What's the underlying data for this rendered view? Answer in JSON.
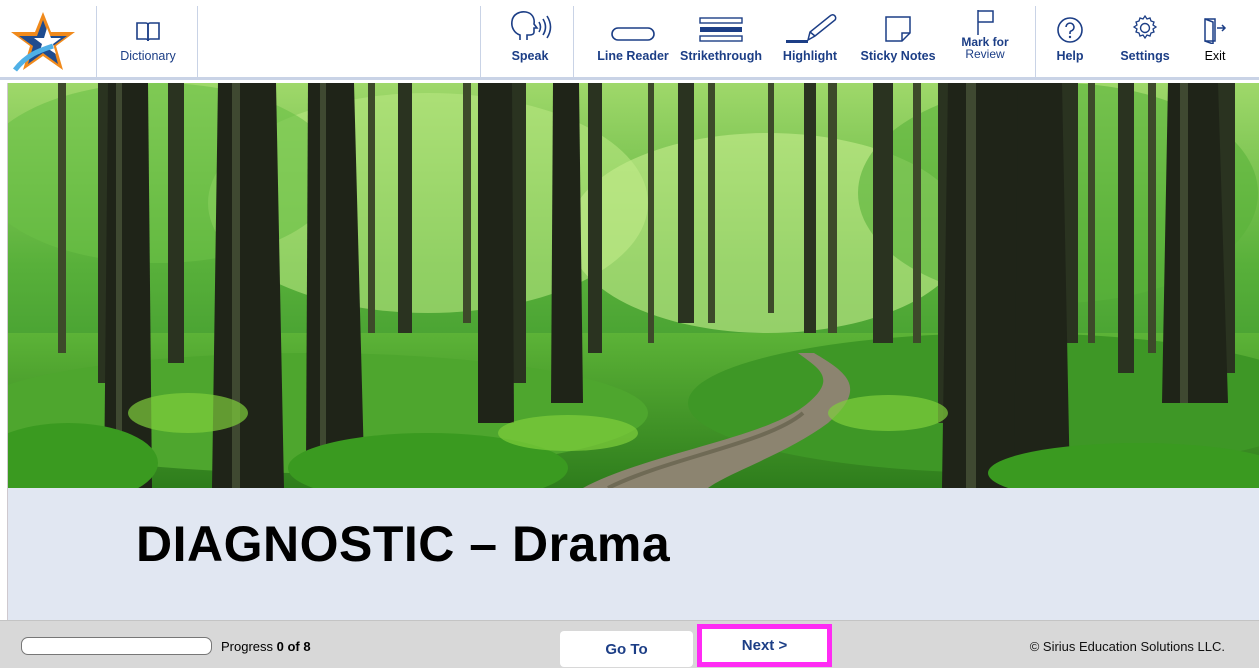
{
  "toolbar": {
    "dictionary": "Dictionary",
    "speak": "Speak",
    "line_reader": "Line Reader",
    "strikethrough": "Strikethrough",
    "highlight": "Highlight",
    "sticky_notes": "Sticky Notes",
    "mark_for_review_line1": "Mark for",
    "mark_for_review_line2": "Review",
    "help": "Help",
    "settings": "Settings",
    "exit": "Exit"
  },
  "icons": {
    "logo": "star-logo-icon",
    "dictionary": "book-icon",
    "speak": "speaking-head-icon",
    "line_reader": "line-reader-icon",
    "strikethrough": "strikethrough-icon",
    "highlight": "highlighter-pen-icon",
    "sticky_notes": "sticky-note-icon",
    "mark_for_review": "flag-icon",
    "help": "question-circle-icon",
    "settings": "gear-icon",
    "exit": "exit-door-icon"
  },
  "main": {
    "title": "DIAGNOSTIC – Drama"
  },
  "footer": {
    "progress_prefix": "Progress ",
    "progress_value": "0 of 8",
    "progress_fraction": 0,
    "goto_label": "Go To",
    "next_label": "Next >",
    "copyright": "© Sirius Education Solutions LLC."
  },
  "colors": {
    "toolbar_label": "#1c3e86",
    "title_background": "#e1e7f2",
    "next_highlight_border": "#ff2bf4",
    "bottom_bar": "#d8d8d8"
  }
}
